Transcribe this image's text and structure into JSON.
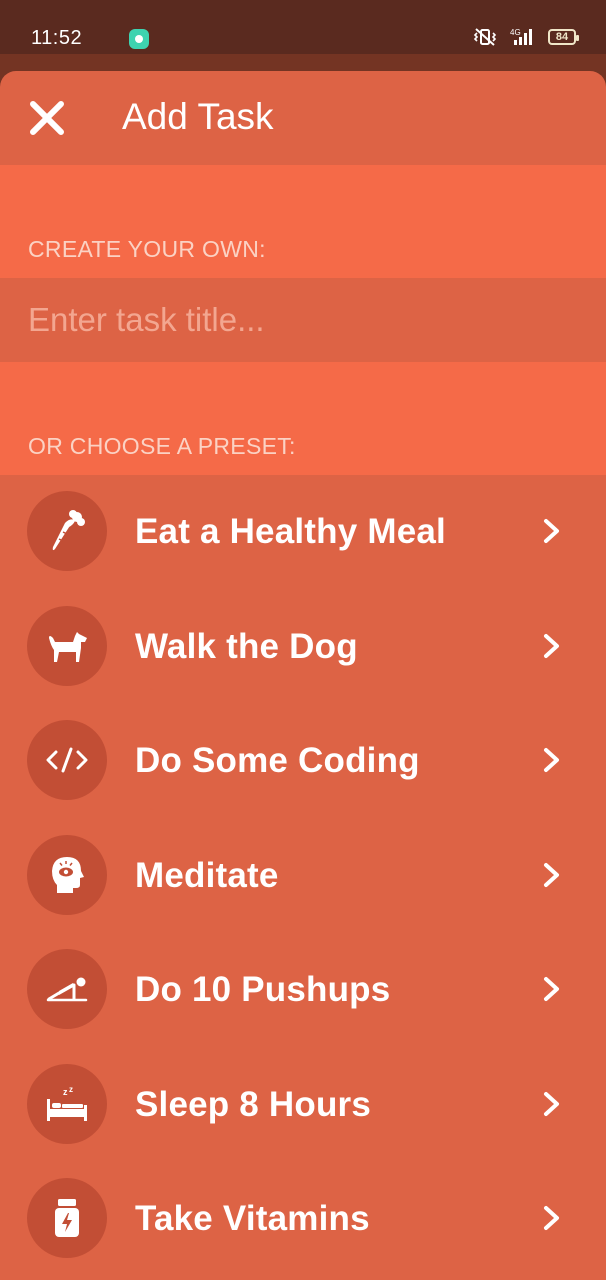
{
  "status_bar": {
    "time": "11:52",
    "network": "4G",
    "battery": "84"
  },
  "header": {
    "title": "Add Task",
    "close_icon": "close-icon"
  },
  "create_section": {
    "label": "CREATE YOUR OWN:",
    "input_placeholder": "Enter task title...",
    "input_value": ""
  },
  "preset_section": {
    "label": "OR CHOOSE A PRESET:",
    "items": [
      {
        "label": "Eat a Healthy Meal",
        "icon": "carrot-icon"
      },
      {
        "label": "Walk the Dog",
        "icon": "dog-icon"
      },
      {
        "label": "Do Some Coding",
        "icon": "code-icon"
      },
      {
        "label": "Meditate",
        "icon": "meditate-head-icon"
      },
      {
        "label": "Do 10 Pushups",
        "icon": "pushup-icon"
      },
      {
        "label": "Sleep 8 Hours",
        "icon": "bed-sleep-icon"
      },
      {
        "label": "Take Vitamins",
        "icon": "vitamin-bottle-icon"
      }
    ]
  },
  "colors": {
    "status_bar": "#5a2a1f",
    "sheet": "#dd6345",
    "band": "#f56a48",
    "avatar": "#c24e35",
    "text": "#ffffff"
  }
}
